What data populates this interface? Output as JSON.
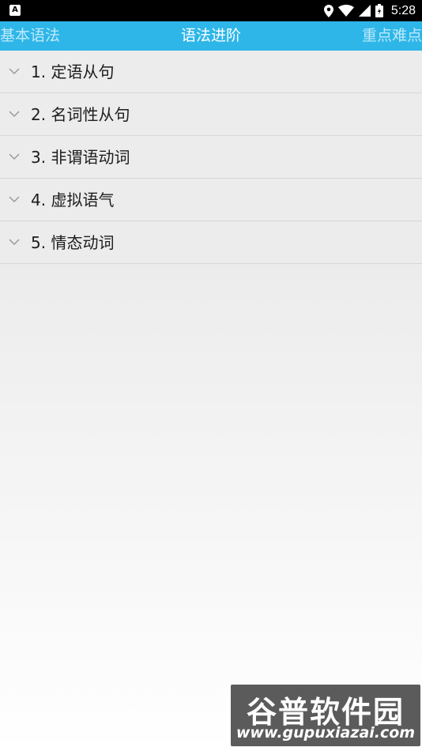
{
  "status_bar": {
    "time": "5:28",
    "icons": [
      "app-notification-icon",
      "location-icon",
      "wifi-icon",
      "signal-icon",
      "battery-icon"
    ]
  },
  "tabs": {
    "left": "基本语法",
    "center": "语法进阶",
    "right": "重点难点"
  },
  "list": [
    {
      "label": "1. 定语从句"
    },
    {
      "label": "2. 名词性从句"
    },
    {
      "label": "3. 非谓语动词"
    },
    {
      "label": "4. 虚拟语气"
    },
    {
      "label": "5. 情态动词"
    }
  ],
  "watermark": {
    "title": "谷普软件园",
    "url": "www.gupuxiazai.com"
  },
  "colors": {
    "title_bar": "#2eb6e8",
    "active_tab": "#ffffff",
    "inactive_tab": "#bfe9fa",
    "list_background": "#ececec"
  }
}
